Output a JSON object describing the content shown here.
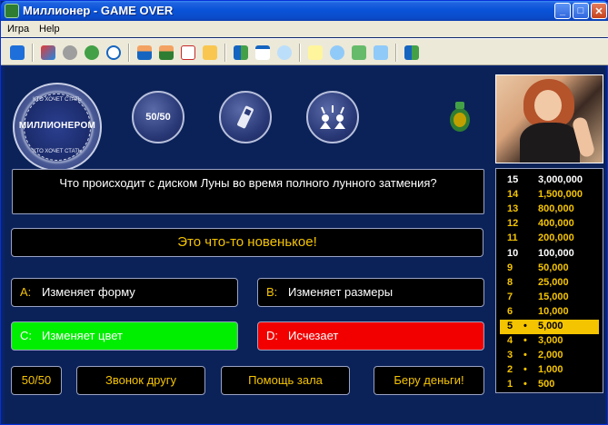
{
  "window": {
    "title": "Миллионер - GAME OVER",
    "minimize_glyph": "_",
    "maximize_glyph": "□",
    "close_glyph": "✕"
  },
  "menu": {
    "items": [
      "Игра",
      "Help"
    ]
  },
  "toolbar": {
    "icons": [
      "ie-icon",
      "ribbon-icon",
      "disc-icon",
      "refresh-icon",
      "clock-icon",
      "user-icon",
      "users-icon",
      "checklist-icon",
      "hand-icon",
      "grid-icon",
      "window-icon",
      "search-icon",
      "help-icon",
      "speech-icon",
      "home-icon",
      "mail-icon",
      "exit-icon"
    ]
  },
  "logo": {
    "top_text": "КТО ХОЧЕТ СТАТЬ",
    "main_text": "МИЛЛИОНЕРОМ",
    "bottom_text": "КТО ХОЧЕТ СТАТЬ"
  },
  "lifelines": {
    "fifty_label": "50/50",
    "phone_icon": "phone-icon",
    "audience_icon": "audience-icon"
  },
  "question": {
    "text": "Что происходит с диском Луны во время полного лунного затмения?"
  },
  "hint": {
    "text": "Это что-то новенькое!"
  },
  "answers": [
    {
      "letter": "A:",
      "text": "Изменяет форму",
      "state": "normal"
    },
    {
      "letter": "B:",
      "text": "Изменяет размеры",
      "state": "normal"
    },
    {
      "letter": "C:",
      "text": "Изменяет цвет",
      "state": "correct"
    },
    {
      "letter": "D:",
      "text": "Исчезает",
      "state": "wrong"
    }
  ],
  "buttons": {
    "fifty": "50/50",
    "phone": "Звонок другу",
    "audience": "Помощь зала",
    "take_money": "Беру деньги!"
  },
  "ladder": [
    {
      "level": "15",
      "amount": "3,000,000",
      "milestone": true,
      "current": false,
      "dot": ""
    },
    {
      "level": "14",
      "amount": "1,500,000",
      "milestone": false,
      "current": false,
      "dot": ""
    },
    {
      "level": "13",
      "amount": "800,000",
      "milestone": false,
      "current": false,
      "dot": ""
    },
    {
      "level": "12",
      "amount": "400,000",
      "milestone": false,
      "current": false,
      "dot": ""
    },
    {
      "level": "11",
      "amount": "200,000",
      "milestone": false,
      "current": false,
      "dot": ""
    },
    {
      "level": "10",
      "amount": "100,000",
      "milestone": true,
      "current": false,
      "dot": ""
    },
    {
      "level": "9",
      "amount": "50,000",
      "milestone": false,
      "current": false,
      "dot": ""
    },
    {
      "level": "8",
      "amount": "25,000",
      "milestone": false,
      "current": false,
      "dot": ""
    },
    {
      "level": "7",
      "amount": "15,000",
      "milestone": false,
      "current": false,
      "dot": ""
    },
    {
      "level": "6",
      "amount": "10,000",
      "milestone": false,
      "current": false,
      "dot": ""
    },
    {
      "level": "5",
      "amount": "5,000",
      "milestone": true,
      "current": true,
      "dot": "•"
    },
    {
      "level": "4",
      "amount": "3,000",
      "milestone": false,
      "current": false,
      "dot": "•"
    },
    {
      "level": "3",
      "amount": "2,000",
      "milestone": false,
      "current": false,
      "dot": "•"
    },
    {
      "level": "2",
      "amount": "1,000",
      "milestone": false,
      "current": false,
      "dot": "•"
    },
    {
      "level": "1",
      "amount": "500",
      "milestone": false,
      "current": false,
      "dot": "•"
    }
  ],
  "colors": {
    "gold": "#f5c400",
    "correct": "#00ee00",
    "wrong": "#f20000",
    "stage": "#0b2258"
  }
}
